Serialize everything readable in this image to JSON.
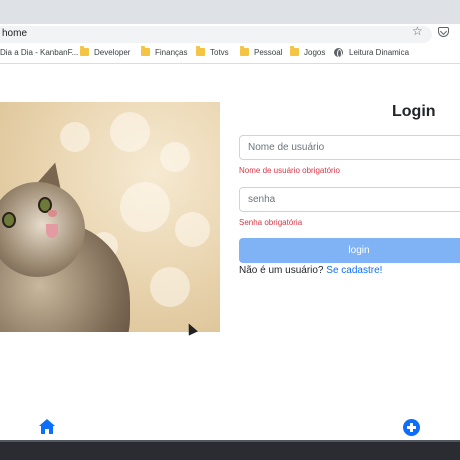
{
  "browser": {
    "url_text": "home",
    "bookmarks": [
      "Dia a Dia - KanbanF...",
      "Developer",
      "Finanças",
      "Totvs",
      "Pessoal",
      "Jogos",
      "Leitura Dinamica"
    ]
  },
  "login": {
    "title": "Login",
    "username_placeholder": "Nome de usuário",
    "username_error": "Nome de usuário obrigatório",
    "password_placeholder": "senha",
    "password_error": "Senha obrigatória",
    "submit_label": "login",
    "signup_prompt": "Não é um usuário?",
    "signup_link": "Se cadastre!"
  },
  "colors": {
    "primary": "#0d6efd",
    "button_disabled": "#7fb3f5",
    "error": "#dc3545"
  },
  "icons": {
    "home": "home-icon",
    "add": "plus-circle-icon"
  }
}
